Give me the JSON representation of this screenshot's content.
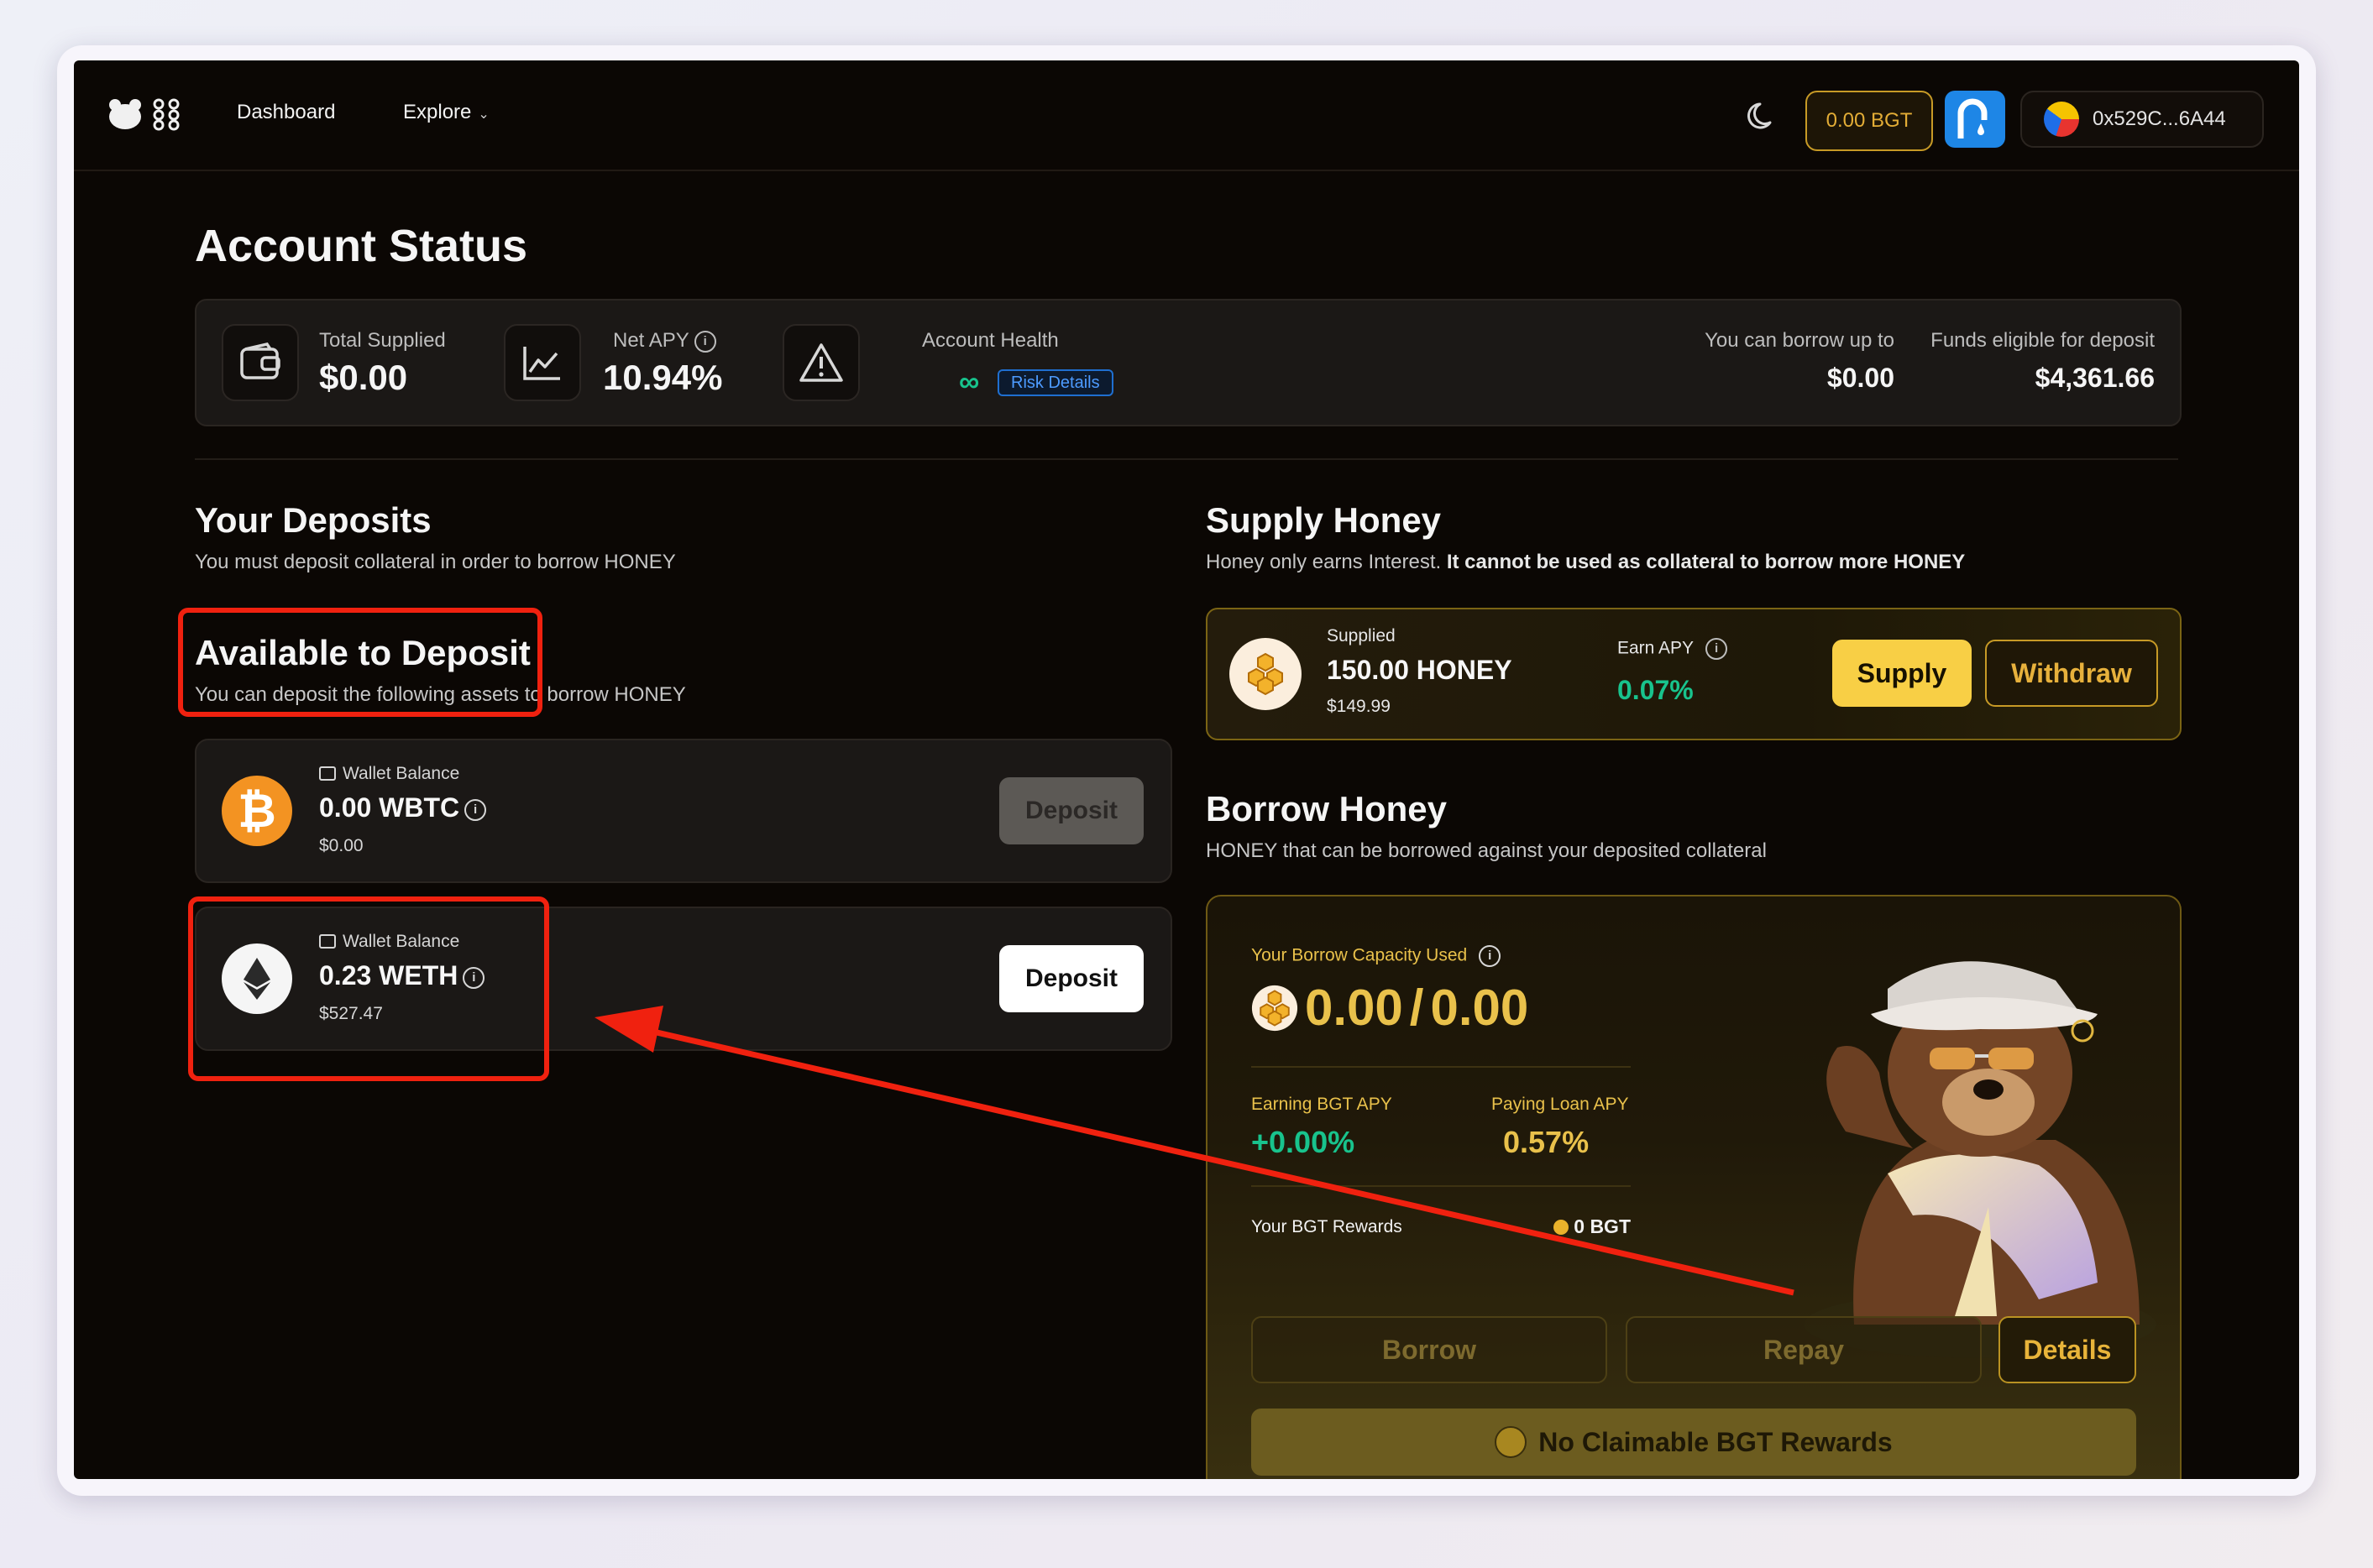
{
  "nav": {
    "dashboard": "Dashboard",
    "explore": "Explore",
    "bgt_balance": "0.00 BGT",
    "wallet_address": "0x529C...6A44"
  },
  "account": {
    "title": "Account Status",
    "total_supplied_label": "Total Supplied",
    "total_supplied": "$0.00",
    "net_apy_label": "Net APY",
    "net_apy": "10.94%",
    "health_label": "Account Health",
    "health_value": "∞",
    "risk_details": "Risk Details",
    "borrow_up_to_label": "You can borrow up to",
    "borrow_up_to": "$0.00",
    "funds_eligible_label": "Funds eligible for deposit",
    "funds_eligible": "$4,361.66"
  },
  "deposits": {
    "title": "Your Deposits",
    "subtitle": "You must deposit collateral in order to borrow HONEY",
    "available_title": "Available to Deposit",
    "available_subtitle": "You can deposit the following assets to borrow HONEY",
    "assets": [
      {
        "wallet_label": "Wallet Balance",
        "amount": "0.00 WBTC",
        "usd": "$0.00",
        "button": "Deposit",
        "enabled": false
      },
      {
        "wallet_label": "Wallet Balance",
        "amount": "0.23 WETH",
        "usd": "$527.47",
        "button": "Deposit",
        "enabled": true
      }
    ]
  },
  "supply": {
    "title": "Supply Honey",
    "subtitle_plain": "Honey only earns Interest.",
    "subtitle_bold": "It cannot be used as collateral to borrow more HONEY",
    "supplied_label": "Supplied",
    "supplied_amount": "150.00 HONEY",
    "supplied_usd": "$149.99",
    "earn_apy_label": "Earn APY",
    "earn_apy": "0.07%",
    "supply_button": "Supply",
    "withdraw_button": "Withdraw"
  },
  "borrow": {
    "title": "Borrow Honey",
    "subtitle": "HONEY that can be borrowed against your deposited collateral",
    "capacity_label": "Your Borrow Capacity Used",
    "capacity_used": "0.00",
    "capacity_sep": "/",
    "capacity_total": "0.00",
    "earning_bgt_label": "Earning BGT APY",
    "earning_bgt": "+0.00%",
    "paying_loan_label": "Paying Loan APY",
    "paying_loan": "0.57%",
    "rewards_label": "Your BGT Rewards",
    "rewards_value": "0 BGT",
    "borrow_button": "Borrow",
    "repay_button": "Repay",
    "details_button": "Details",
    "claim_text": "No Claimable BGT Rewards"
  },
  "colors": {
    "accent_gold": "#e9c14b",
    "positive_green": "#18c38d",
    "annotation_red": "#f0210f"
  }
}
